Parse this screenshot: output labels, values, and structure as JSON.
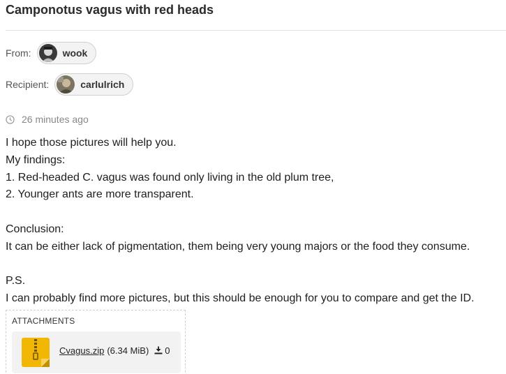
{
  "message": {
    "subject": "Camponotus vagus with red heads",
    "from_label": "From:",
    "from_name": "wook",
    "recipient_label": "Recipient:",
    "recipient_name": "carlulrich",
    "timestamp": "26 minutes ago",
    "body_lines": [
      "I hope those pictures will help you.",
      "My findings:",
      "1. Red-headed C. vagus was found only living in the old plum tree,",
      "2. Younger ants are more transparent.",
      "",
      "Conclusion:",
      "It can be either lack of pigmentation, them being very young majors or the food they consume.",
      "",
      "P.S.",
      "I can probably find more pictures, but this should be enough for you to compare and get the ID."
    ]
  },
  "attachments": {
    "title": "ATTACHMENTS",
    "items": [
      {
        "file_name": "Cvagus.zip",
        "size": "(6.34 MiB)",
        "download_count": "0",
        "icon": "zip-file-icon"
      }
    ]
  },
  "colors": {
    "chip_background": "#f3f3f3",
    "zip_icon": "#f2b705",
    "muted_text": "#888888"
  }
}
